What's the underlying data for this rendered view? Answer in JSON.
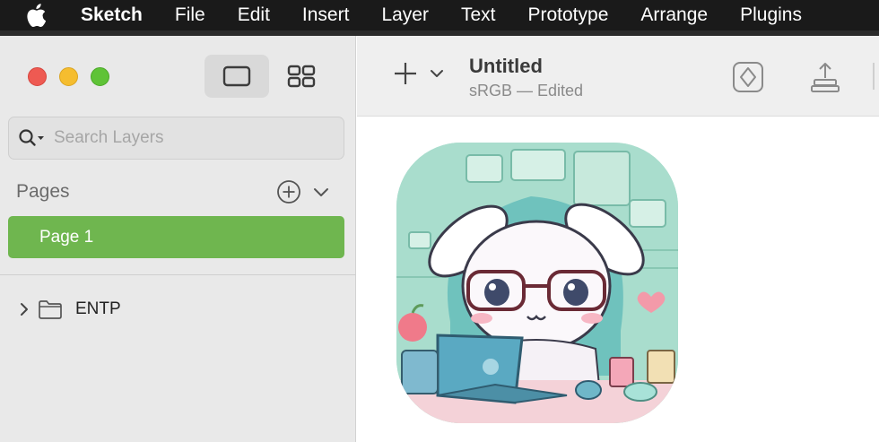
{
  "menubar": {
    "app": "Sketch",
    "items": [
      "File",
      "Edit",
      "Insert",
      "Layer",
      "Text",
      "Prototype",
      "Arrange",
      "Plugins"
    ]
  },
  "sidebar": {
    "search": {
      "placeholder": "Search Layers",
      "value": ""
    },
    "pages_title": "Pages",
    "pages": [
      {
        "label": "Page 1",
        "selected": true
      }
    ],
    "layers": [
      {
        "label": "ENTP",
        "type": "folder",
        "expanded": false
      }
    ]
  },
  "toolbar": {
    "doc_title": "Untitled",
    "doc_subtitle": "sRGB — Edited"
  },
  "colors": {
    "page_selected": "#6fb64f",
    "close": "#ee5a52",
    "minimize": "#f5bd2f",
    "zoom": "#5fc337"
  }
}
